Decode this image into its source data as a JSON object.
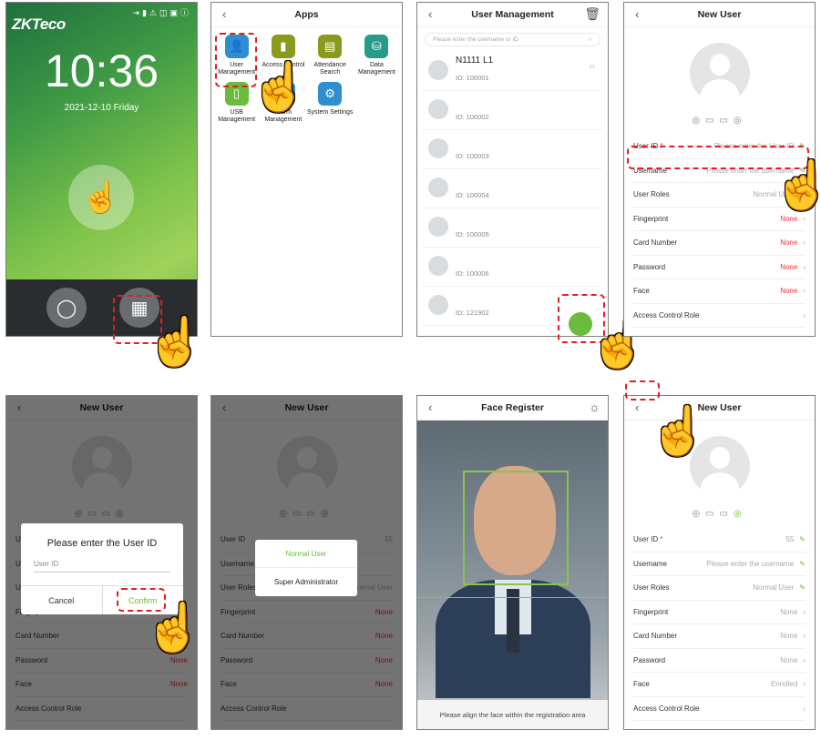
{
  "home": {
    "logo": "ZKTeco",
    "time": "10:36",
    "date": "2021-12-10   Friday"
  },
  "apps": {
    "title": "Apps",
    "items": [
      {
        "label": "User Management",
        "icon": "user-icon"
      },
      {
        "label": "Access Control",
        "icon": "door-icon"
      },
      {
        "label": "Attendance Search",
        "icon": "doc-icon"
      },
      {
        "label": "Data Management",
        "icon": "database-icon"
      },
      {
        "label": "USB Management",
        "icon": "usb-icon"
      },
      {
        "label": "Alarm Management",
        "icon": "alarm-icon"
      },
      {
        "label": "System Settings",
        "icon": "gear-icon"
      }
    ]
  },
  "user_mgmt": {
    "title": "User Management",
    "search_placeholder": "Please enter the username or ID",
    "users": [
      {
        "name": "N1111 L1",
        "id": "ID: 100001"
      },
      {
        "name": "",
        "id": "ID: 100002"
      },
      {
        "name": "",
        "id": "ID: 100003"
      },
      {
        "name": "",
        "id": "ID: 100004"
      },
      {
        "name": "",
        "id": "ID: 100005"
      },
      {
        "name": "",
        "id": "ID: 100006"
      },
      {
        "name": "",
        "id": "ID: 121902"
      }
    ]
  },
  "new_user": {
    "title": "New User",
    "labels": {
      "user_id": "User ID",
      "username": "Username",
      "roles": "User Roles",
      "fingerprint": "Fingerprint",
      "card": "Card Number",
      "password": "Password",
      "face": "Face",
      "acr": "Access Control Role"
    },
    "placeholders": {
      "user_id": "Please enter the User ID",
      "username": "Please enter the username"
    },
    "values": {
      "roles": "Normal User",
      "none": "None",
      "id_filled": "55",
      "enrolled": "Enrolled"
    }
  },
  "dialog": {
    "title": "Please enter the User ID",
    "field": "User ID",
    "cancel": "Cancel",
    "confirm": "Confirm"
  },
  "roles_menu": {
    "normal": "Normal User",
    "super": "Super Administrator"
  },
  "face": {
    "title": "Face Register",
    "caption": "Please align the face within the registration area"
  }
}
